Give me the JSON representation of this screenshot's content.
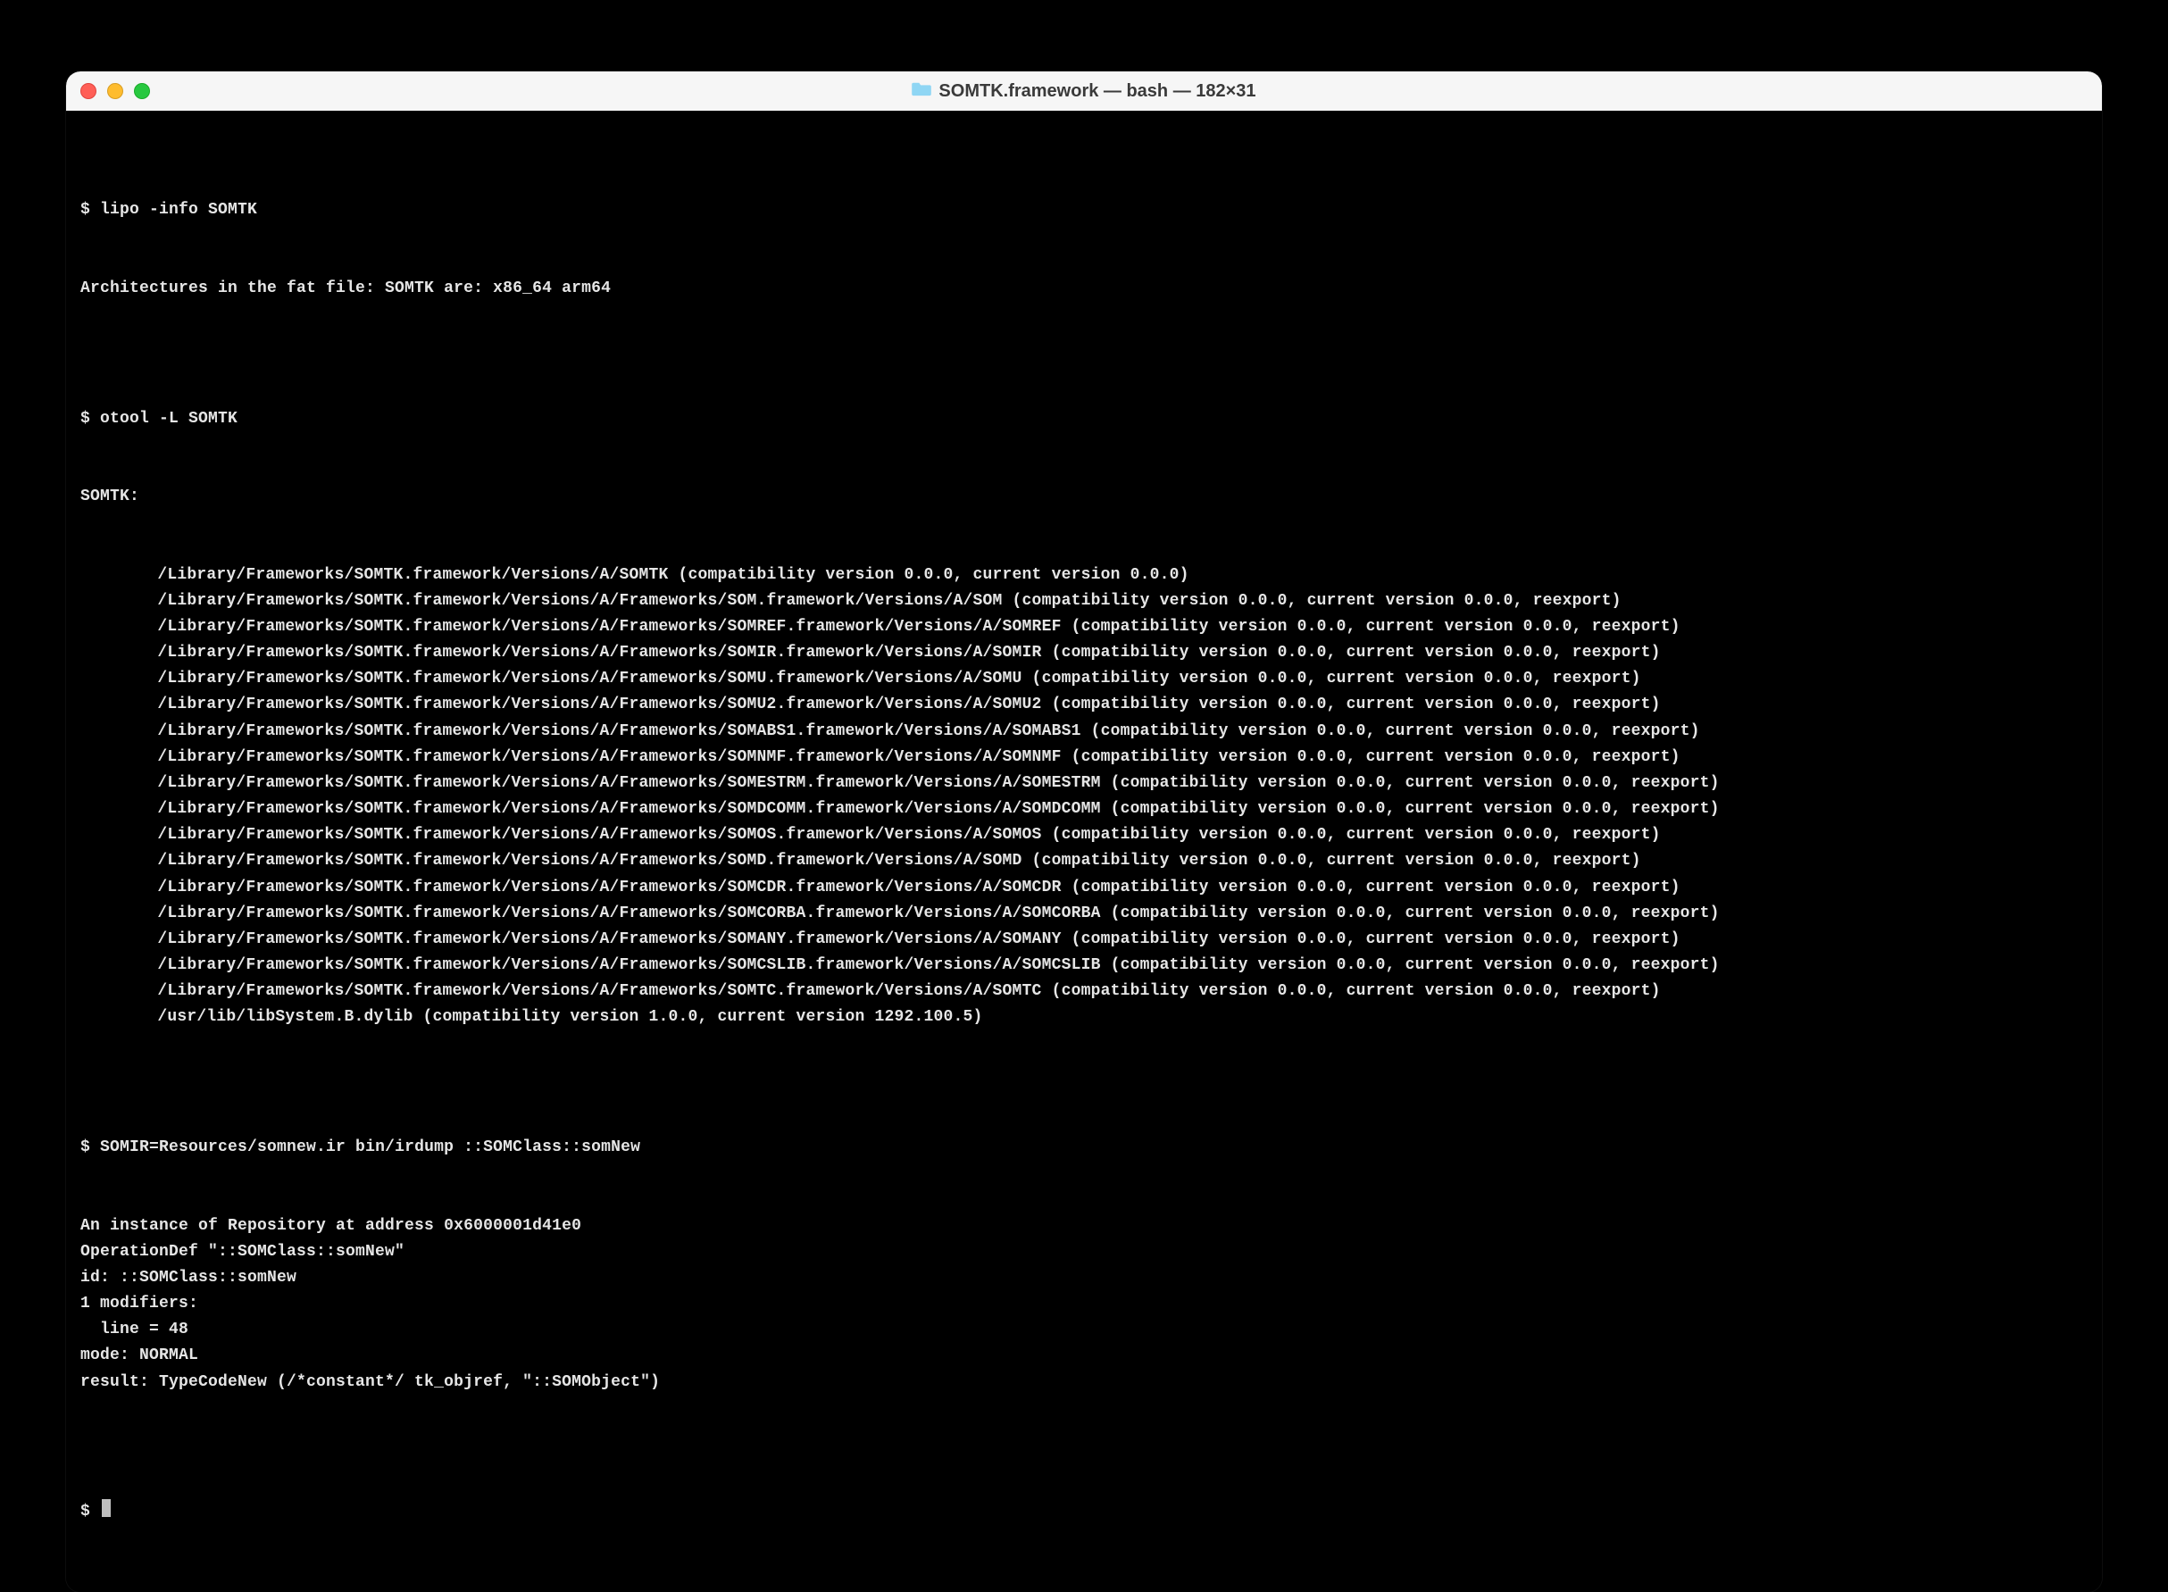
{
  "window": {
    "title": "SOMTK.framework — bash — 182×31"
  },
  "session": {
    "commands": [
      {
        "prompt": "$ ",
        "input": "lipo -info SOMTK"
      },
      {
        "prompt": "$ ",
        "input": "otool -L SOMTK"
      },
      {
        "prompt": "$ ",
        "input": "SOMIR=Resources/somnew.ir bin/irdump ::SOMClass::somNew"
      },
      {
        "prompt": "$ ",
        "input": ""
      }
    ],
    "lipo_output": "Architectures in the fat file: SOMTK are: x86_64 arm64",
    "otool_header": "SOMTK:",
    "otool_lines": [
      "/Library/Frameworks/SOMTK.framework/Versions/A/SOMTK (compatibility version 0.0.0, current version 0.0.0)",
      "/Library/Frameworks/SOMTK.framework/Versions/A/Frameworks/SOM.framework/Versions/A/SOM (compatibility version 0.0.0, current version 0.0.0, reexport)",
      "/Library/Frameworks/SOMTK.framework/Versions/A/Frameworks/SOMREF.framework/Versions/A/SOMREF (compatibility version 0.0.0, current version 0.0.0, reexport)",
      "/Library/Frameworks/SOMTK.framework/Versions/A/Frameworks/SOMIR.framework/Versions/A/SOMIR (compatibility version 0.0.0, current version 0.0.0, reexport)",
      "/Library/Frameworks/SOMTK.framework/Versions/A/Frameworks/SOMU.framework/Versions/A/SOMU (compatibility version 0.0.0, current version 0.0.0, reexport)",
      "/Library/Frameworks/SOMTK.framework/Versions/A/Frameworks/SOMU2.framework/Versions/A/SOMU2 (compatibility version 0.0.0, current version 0.0.0, reexport)",
      "/Library/Frameworks/SOMTK.framework/Versions/A/Frameworks/SOMABS1.framework/Versions/A/SOMABS1 (compatibility version 0.0.0, current version 0.0.0, reexport)",
      "/Library/Frameworks/SOMTK.framework/Versions/A/Frameworks/SOMNMF.framework/Versions/A/SOMNMF (compatibility version 0.0.0, current version 0.0.0, reexport)",
      "/Library/Frameworks/SOMTK.framework/Versions/A/Frameworks/SOMESTRM.framework/Versions/A/SOMESTRM (compatibility version 0.0.0, current version 0.0.0, reexport)",
      "/Library/Frameworks/SOMTK.framework/Versions/A/Frameworks/SOMDCOMM.framework/Versions/A/SOMDCOMM (compatibility version 0.0.0, current version 0.0.0, reexport)",
      "/Library/Frameworks/SOMTK.framework/Versions/A/Frameworks/SOMOS.framework/Versions/A/SOMOS (compatibility version 0.0.0, current version 0.0.0, reexport)",
      "/Library/Frameworks/SOMTK.framework/Versions/A/Frameworks/SOMD.framework/Versions/A/SOMD (compatibility version 0.0.0, current version 0.0.0, reexport)",
      "/Library/Frameworks/SOMTK.framework/Versions/A/Frameworks/SOMCDR.framework/Versions/A/SOMCDR (compatibility version 0.0.0, current version 0.0.0, reexport)",
      "/Library/Frameworks/SOMTK.framework/Versions/A/Frameworks/SOMCORBA.framework/Versions/A/SOMCORBA (compatibility version 0.0.0, current version 0.0.0, reexport)",
      "/Library/Frameworks/SOMTK.framework/Versions/A/Frameworks/SOMANY.framework/Versions/A/SOMANY (compatibility version 0.0.0, current version 0.0.0, reexport)",
      "/Library/Frameworks/SOMTK.framework/Versions/A/Frameworks/SOMCSLIB.framework/Versions/A/SOMCSLIB (compatibility version 0.0.0, current version 0.0.0, reexport)",
      "/Library/Frameworks/SOMTK.framework/Versions/A/Frameworks/SOMTC.framework/Versions/A/SOMTC (compatibility version 0.0.0, current version 0.0.0, reexport)",
      "/usr/lib/libSystem.B.dylib (compatibility version 1.0.0, current version 1292.100.5)"
    ],
    "irdump_output": [
      "An instance of Repository at address 0x6000001d41e0",
      "OperationDef \"::SOMClass::somNew\"",
      "id: ::SOMClass::somNew",
      "1 modifiers:",
      "  line = 48",
      "mode: NORMAL",
      "result: TypeCodeNew (/*constant*/ tk_objref, \"::SOMObject\")"
    ]
  }
}
